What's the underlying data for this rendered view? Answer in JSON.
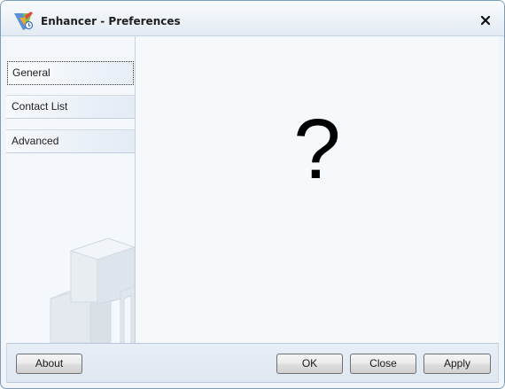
{
  "window": {
    "title": "Enhancer - Preferences",
    "close_glyph": "✖"
  },
  "sidebar": {
    "items": [
      {
        "label": "General",
        "selected": true
      },
      {
        "label": "Contact List",
        "selected": false
      },
      {
        "label": "Advanced",
        "selected": false
      }
    ]
  },
  "content": {
    "placeholder_glyph": "?"
  },
  "footer": {
    "about_label": "About",
    "ok_label": "OK",
    "close_label": "Close",
    "apply_label": "Apply"
  },
  "icons": {
    "app": "app-logo-icon",
    "close": "close-icon",
    "sidebar_art": "stacked-boxes-illustration"
  },
  "colors": {
    "window_bg": "#f1f5fa",
    "border": "#7e9db9"
  }
}
